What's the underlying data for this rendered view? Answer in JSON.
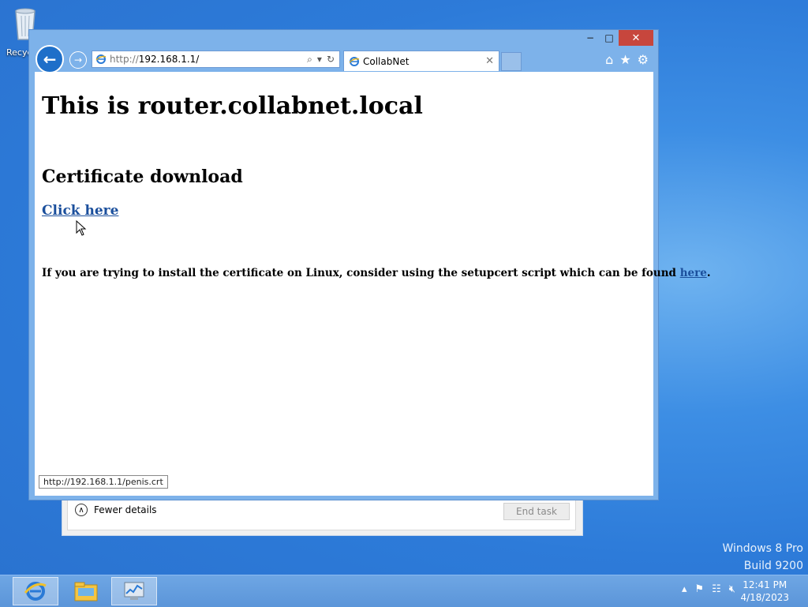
{
  "desktop": {
    "recycle_bin_label": "Recyc"
  },
  "watermark": {
    "line1": "Windows 8 Pro",
    "line2": "Build 9200"
  },
  "task_manager": {
    "fewer_details": "Fewer details",
    "end_task": "End task"
  },
  "browser": {
    "address_scheme": "http://",
    "address_host": "192.168.1.1/",
    "tab_title": "CollabNet",
    "caption": {
      "minimize": "−",
      "maximize": "□",
      "close": "✕"
    }
  },
  "page": {
    "heading": "This is router.collabnet.local",
    "subheading": "Certificate download",
    "download_link": "Click here",
    "linux_text": "If you are trying to install the certificate on Linux, consider using the setupcert script which can be found ",
    "linux_link": "here",
    "linux_period": "."
  },
  "status_bar": {
    "url": "http://192.168.1.1/penis.crt"
  },
  "taskbar": {
    "time": "12:41 PM",
    "date": "4/18/2023"
  }
}
